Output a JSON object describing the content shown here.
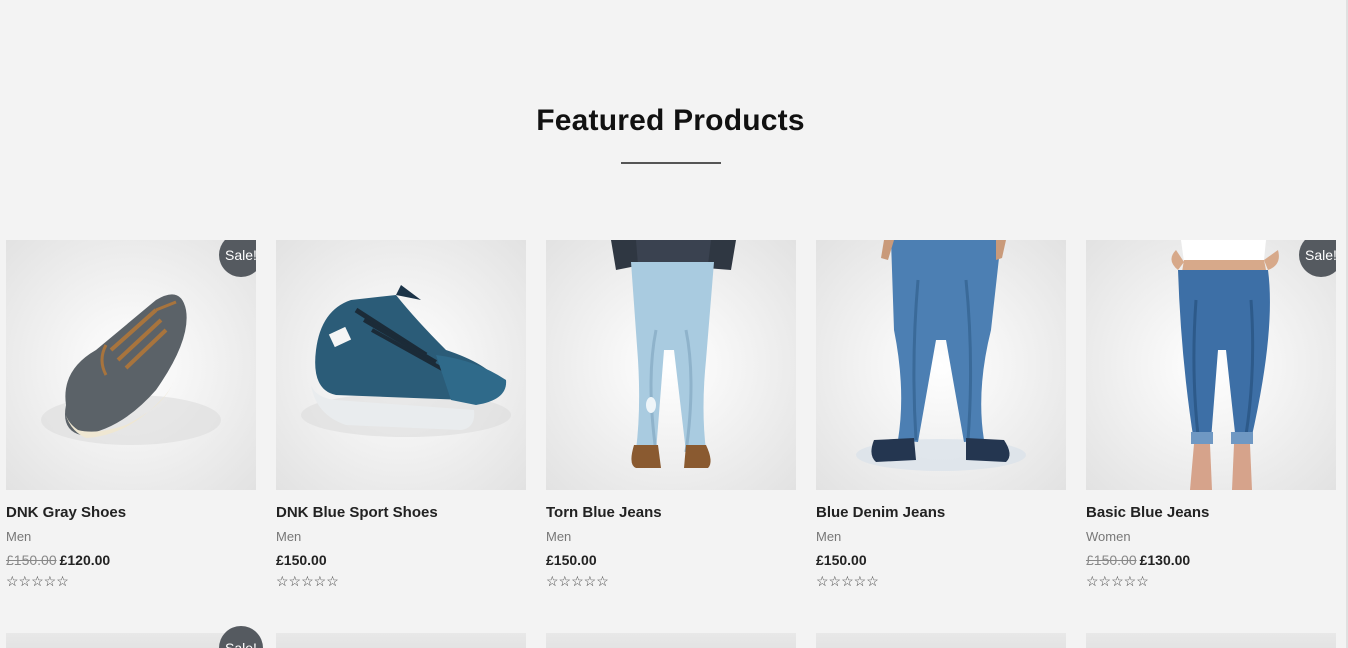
{
  "section": {
    "title": "Featured Products"
  },
  "products": [
    {
      "title": "DNK Gray Shoes",
      "category": "Men",
      "old_price": "£150.00",
      "price": "£120.00",
      "sale_badge": "Sale!",
      "rating": 0,
      "stars": "☆☆☆☆☆",
      "image_icon": "gray-shoe-image"
    },
    {
      "title": "DNK Blue Sport Shoes",
      "category": "Men",
      "price": "£150.00",
      "rating": 0,
      "stars": "☆☆☆☆☆",
      "image_icon": "blue-sport-shoe-image"
    },
    {
      "title": "Torn Blue Jeans",
      "category": "Men",
      "price": "£150.00",
      "rating": 0,
      "stars": "☆☆☆☆☆",
      "image_icon": "torn-jeans-image"
    },
    {
      "title": "Blue Denim Jeans",
      "category": "Men",
      "price": "£150.00",
      "rating": 0,
      "stars": "☆☆☆☆☆",
      "image_icon": "denim-jeans-image"
    },
    {
      "title": "Basic Blue Jeans",
      "category": "Women",
      "old_price": "£150.00",
      "price": "£130.00",
      "sale_badge": "Sale!",
      "rating": 0,
      "stars": "☆☆☆☆☆",
      "image_icon": "womens-jeans-image"
    }
  ],
  "second_row": {
    "sale_badge": "Sale!"
  },
  "colors": {
    "background": "#f3f3f3",
    "badge": "#555a60",
    "title_text": "#222222",
    "muted_text": "#777777"
  }
}
